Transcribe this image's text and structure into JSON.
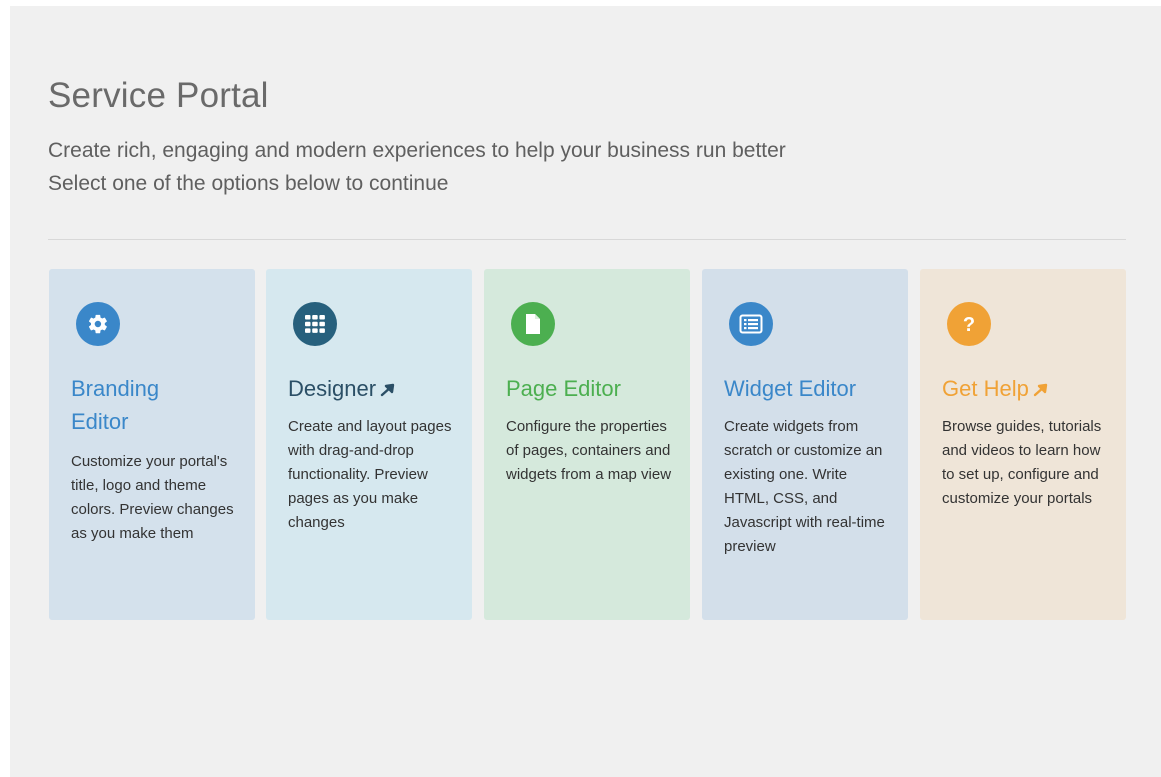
{
  "header": {
    "title": "Service Portal",
    "subtitle_line1": "Create rich, engaging and modern experiences to help your business run better",
    "subtitle_line2": "Select one of the options below to continue"
  },
  "cards": [
    {
      "title_line1": "Branding",
      "title_line2": "Editor",
      "description": "Customize your portal's title, logo and theme colors. Preview changes as you make them",
      "icon": "gear-icon",
      "background": "#d4e1ec",
      "accent": "#3a87c9",
      "title_color": "#3a87c9"
    },
    {
      "title": "Designer",
      "external_link": true,
      "description": "Create and layout pages with drag-and-drop functionality. Preview pages as you make changes",
      "icon": "grid-icon",
      "background": "#d6e8ef",
      "accent": "#27607d",
      "title_color": "#2b4f66"
    },
    {
      "title": "Page Editor",
      "description": "Configure the properties of pages, containers and widgets from a map view",
      "icon": "document-icon",
      "background": "#d5e9dc",
      "accent": "#4caf50",
      "title_color": "#4caf50"
    },
    {
      "title": "Widget Editor",
      "description": "Create widgets from scratch or customize an existing one. Write HTML, CSS, and Javascript with real-time preview",
      "icon": "widget-list-icon",
      "background": "#d3dfea",
      "accent": "#3a87c9",
      "title_color": "#3a87c9"
    },
    {
      "title": "Get Help",
      "external_link": true,
      "description": "Browse guides, tutorials and videos to learn how to set up, configure and customize your portals",
      "icon": "question-icon",
      "background": "#efe5d8",
      "accent": "#f0a236",
      "title_color": "#f0a236"
    }
  ]
}
